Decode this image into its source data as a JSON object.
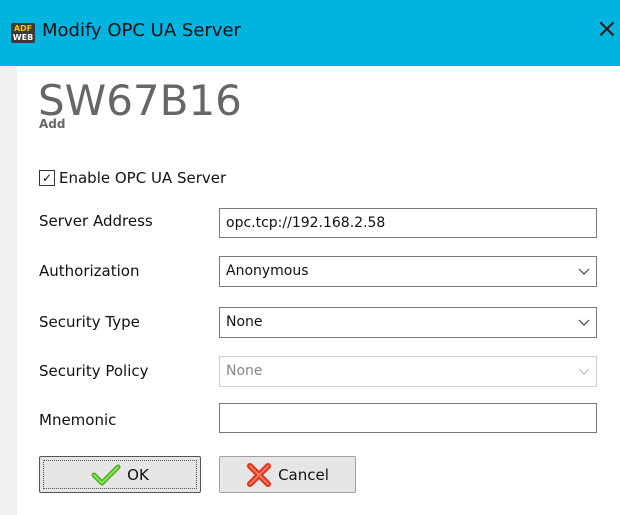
{
  "window": {
    "title": "Modify OPC UA Server",
    "icon_top": "ADF",
    "icon_bottom": "WEB",
    "close_symbol": "×"
  },
  "header": {
    "device_name": "SW67B16",
    "mode": "Add"
  },
  "enable": {
    "label": "Enable OPC UA Server",
    "checked": true,
    "check_symbol": "✓"
  },
  "fields": {
    "server_address": {
      "label": "Server Address",
      "value": "opc.tcp://192.168.2.58"
    },
    "authorization": {
      "label": "Authorization",
      "value": "Anonymous"
    },
    "security_type": {
      "label": "Security Type",
      "value": "None"
    },
    "security_policy": {
      "label": "Security Policy",
      "value": "None",
      "disabled": true
    },
    "mnemonic": {
      "label": "Mnemonic",
      "value": ""
    }
  },
  "buttons": {
    "ok": {
      "label": "OK",
      "icon": "checkmark-icon"
    },
    "cancel": {
      "label": "Cancel",
      "icon": "red-x-icon"
    }
  },
  "colors": {
    "titlebar": "#00b4e0",
    "ok_icon": "#4caf20",
    "cancel_icon": "#e03020"
  }
}
